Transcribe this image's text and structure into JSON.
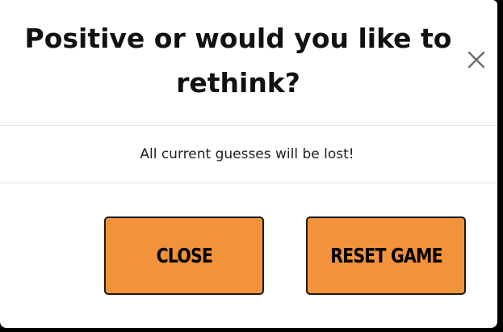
{
  "dialog": {
    "title": "Positive or would you like to rethink?",
    "message": "All current guesses will be lost!",
    "close_icon": "close-icon"
  },
  "buttons": {
    "close_label": "CLOSE",
    "reset_label": "RESET GAME"
  },
  "colors": {
    "button_bg": "#f2923a",
    "button_border": "#1a1a1a",
    "divider": "#e3e3e3",
    "title_text": "#111111"
  }
}
